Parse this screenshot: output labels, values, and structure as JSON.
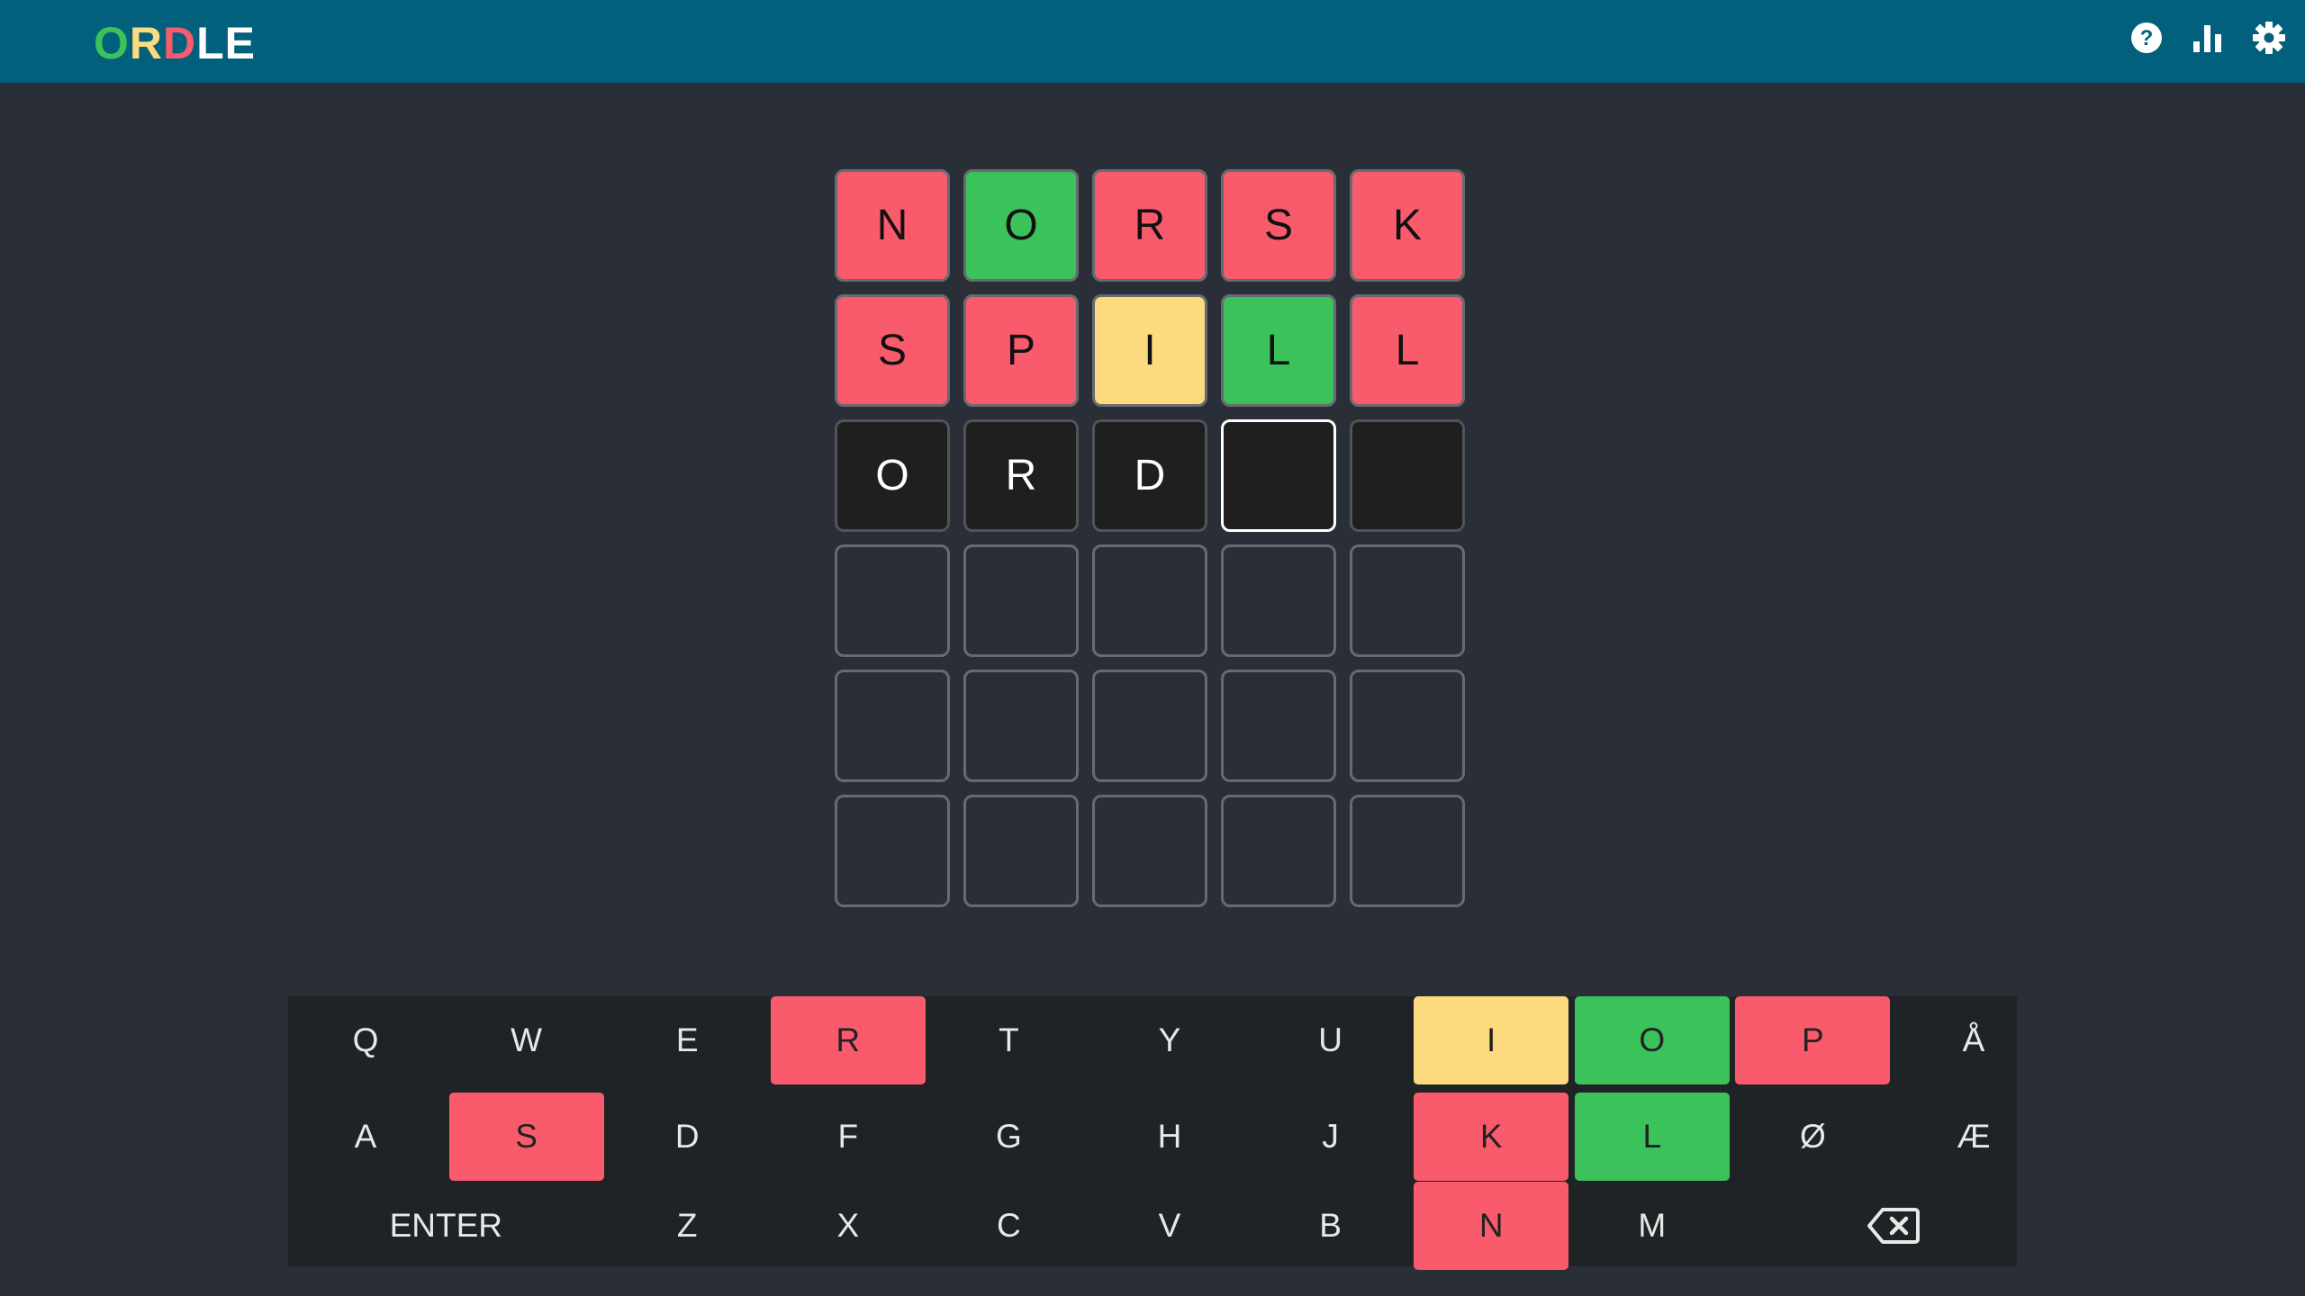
{
  "header": {
    "logo_letters": [
      {
        "char": "O",
        "color": "#3bc25a"
      },
      {
        "char": "R",
        "color": "#fbdb7d"
      },
      {
        "char": "D",
        "color": "#fa5b6c"
      },
      {
        "char": "L",
        "color": "#ffffff"
      },
      {
        "char": "E",
        "color": "#ffffff"
      }
    ],
    "icons": [
      "help-icon",
      "stats-icon",
      "settings-icon"
    ]
  },
  "colors": {
    "header_bg": "#03607d",
    "page_bg": "#2a2f37",
    "correct": "#3bc25a",
    "present": "#fbdb7d",
    "absent": "#fa5b6c"
  },
  "board": {
    "rows": [
      [
        {
          "letter": "N",
          "state": "absent"
        },
        {
          "letter": "O",
          "state": "correct"
        },
        {
          "letter": "R",
          "state": "absent"
        },
        {
          "letter": "S",
          "state": "absent"
        },
        {
          "letter": "K",
          "state": "absent"
        }
      ],
      [
        {
          "letter": "S",
          "state": "absent"
        },
        {
          "letter": "P",
          "state": "absent"
        },
        {
          "letter": "I",
          "state": "present"
        },
        {
          "letter": "L",
          "state": "correct"
        },
        {
          "letter": "L",
          "state": "absent"
        }
      ],
      [
        {
          "letter": "O",
          "state": "typed"
        },
        {
          "letter": "R",
          "state": "typed"
        },
        {
          "letter": "D",
          "state": "typed"
        },
        {
          "letter": "",
          "state": "cursor"
        },
        {
          "letter": "",
          "state": "blank-dark"
        }
      ],
      [
        {
          "letter": "",
          "state": "empty"
        },
        {
          "letter": "",
          "state": "empty"
        },
        {
          "letter": "",
          "state": "empty"
        },
        {
          "letter": "",
          "state": "empty"
        },
        {
          "letter": "",
          "state": "empty"
        }
      ],
      [
        {
          "letter": "",
          "state": "empty"
        },
        {
          "letter": "",
          "state": "empty"
        },
        {
          "letter": "",
          "state": "empty"
        },
        {
          "letter": "",
          "state": "empty"
        },
        {
          "letter": "",
          "state": "empty"
        }
      ],
      [
        {
          "letter": "",
          "state": "empty"
        },
        {
          "letter": "",
          "state": "empty"
        },
        {
          "letter": "",
          "state": "empty"
        },
        {
          "letter": "",
          "state": "empty"
        },
        {
          "letter": "",
          "state": "empty"
        }
      ]
    ]
  },
  "keyboard": {
    "rows": [
      [
        {
          "label": "Q",
          "state": ""
        },
        {
          "label": "W",
          "state": ""
        },
        {
          "label": "E",
          "state": ""
        },
        {
          "label": "R",
          "state": "absent"
        },
        {
          "label": "T",
          "state": ""
        },
        {
          "label": "Y",
          "state": ""
        },
        {
          "label": "U",
          "state": ""
        },
        {
          "label": "I",
          "state": "present"
        },
        {
          "label": "O",
          "state": "correct"
        },
        {
          "label": "P",
          "state": "absent"
        },
        {
          "label": "Å",
          "state": ""
        }
      ],
      [
        {
          "label": "A",
          "state": ""
        },
        {
          "label": "S",
          "state": "absent"
        },
        {
          "label": "D",
          "state": ""
        },
        {
          "label": "F",
          "state": ""
        },
        {
          "label": "G",
          "state": ""
        },
        {
          "label": "H",
          "state": ""
        },
        {
          "label": "J",
          "state": ""
        },
        {
          "label": "K",
          "state": "absent"
        },
        {
          "label": "L",
          "state": "correct"
        },
        {
          "label": "Ø",
          "state": ""
        },
        {
          "label": "Æ",
          "state": ""
        }
      ],
      [
        {
          "label": "ENTER",
          "state": "",
          "wide": true
        },
        {
          "label": "Z",
          "state": ""
        },
        {
          "label": "X",
          "state": ""
        },
        {
          "label": "C",
          "state": ""
        },
        {
          "label": "V",
          "state": ""
        },
        {
          "label": "B",
          "state": ""
        },
        {
          "label": "N",
          "state": "absent"
        },
        {
          "label": "M",
          "state": ""
        },
        {
          "label": "",
          "state": "",
          "wide": true,
          "icon": "backspace-icon"
        }
      ]
    ]
  }
}
